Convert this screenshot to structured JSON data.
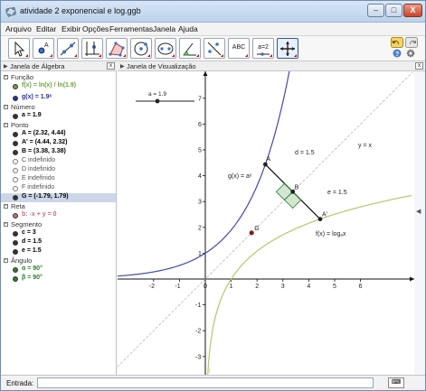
{
  "window": {
    "title": "atividade 2 exponencial e log.ggb",
    "minimize": "–",
    "maximize": "□",
    "close": "X"
  },
  "menu": [
    "Arquivo",
    "Editar",
    "Exibir",
    "Opções",
    "Ferramentas",
    "Janela",
    "Ajuda"
  ],
  "toolbar": {
    "text_tool_label": "ABC",
    "slider_tool_label": "a=2"
  },
  "algebra": {
    "title": "Janela de Álgebra",
    "rows": [
      {
        "type": "cat",
        "label": "Função"
      },
      {
        "type": "item",
        "label": "f(x) = ln(x) / ln(1.9)",
        "color": "#6aa33a",
        "dot": "#6aa33a"
      },
      {
        "type": "item",
        "label": "g(x) = 1.9ˣ",
        "color": "#2a2aa8",
        "dot": "#2a2aa8"
      },
      {
        "type": "cat",
        "label": "Número"
      },
      {
        "type": "item",
        "label": "a = 1.9",
        "color": "#000000",
        "dot": "#333333"
      },
      {
        "type": "cat",
        "label": "Ponto"
      },
      {
        "type": "item",
        "label": "A = (2.32, 4.44)",
        "color": "#000000",
        "dot": "#333333"
      },
      {
        "type": "item",
        "label": "A' = (4.44, 2.32)",
        "color": "#000000",
        "dot": "#333333"
      },
      {
        "type": "item",
        "label": "B = (3.38, 3.38)",
        "color": "#000000",
        "dot": "#333333"
      },
      {
        "type": "item",
        "label": "C indefinido",
        "color": "#555555",
        "dot": ""
      },
      {
        "type": "item",
        "label": "D indefinido",
        "color": "#555555",
        "dot": ""
      },
      {
        "type": "item",
        "label": "E indefinido",
        "color": "#555555",
        "dot": ""
      },
      {
        "type": "item",
        "label": "F indefinido",
        "color": "#555555",
        "dot": ""
      },
      {
        "type": "item",
        "label": "G = (-1.79, 1.79)",
        "color": "#000000",
        "dot": "#333333",
        "selected": true
      },
      {
        "type": "cat",
        "label": "Reta"
      },
      {
        "type": "item",
        "label": "b: -x + y = 0",
        "color": "#c86a7a",
        "dot": "#c86a7a"
      },
      {
        "type": "cat",
        "label": "Segmento"
      },
      {
        "type": "item",
        "label": "c = 3",
        "color": "#000000",
        "dot": "#333333"
      },
      {
        "type": "item",
        "label": "d = 1.5",
        "color": "#000000",
        "dot": "#333333"
      },
      {
        "type": "item",
        "label": "e = 1.5",
        "color": "#000000",
        "dot": "#333333"
      },
      {
        "type": "cat",
        "label": "Ângulo"
      },
      {
        "type": "item",
        "label": "α = 90°",
        "color": "#2e7d2e",
        "dot": "#2e7d2e"
      },
      {
        "type": "item",
        "label": "β = 90°",
        "color": "#2e7d2e",
        "dot": "#2e7d2e"
      }
    ]
  },
  "view": {
    "title": "Janela de Visualização",
    "slider_label": "a = 1.9",
    "xticks": [
      "-2",
      "-1",
      "0",
      "1",
      "2",
      "3",
      "4",
      "5",
      "6"
    ],
    "yticks": [
      "-3",
      "-2",
      "-1",
      "1",
      "2",
      "3",
      "4",
      "5",
      "6",
      "7"
    ],
    "labels": {
      "A": "A",
      "Ap": "A'",
      "B": "B",
      "G": "G",
      "d": "d = 1.5",
      "e": "e = 1.5",
      "yx": "y = x",
      "g": "g(x) = aˣ",
      "f": "f(x) = logₐx",
      "f_tail": "f"
    },
    "colors": {
      "g": "#4646b4",
      "f": "#b4c86a",
      "line": "#b4b4b4",
      "square": "#7dbb7d",
      "pointG": "#8b1a1a"
    }
  },
  "input": {
    "label": "Entrada:",
    "button": "⌨"
  }
}
